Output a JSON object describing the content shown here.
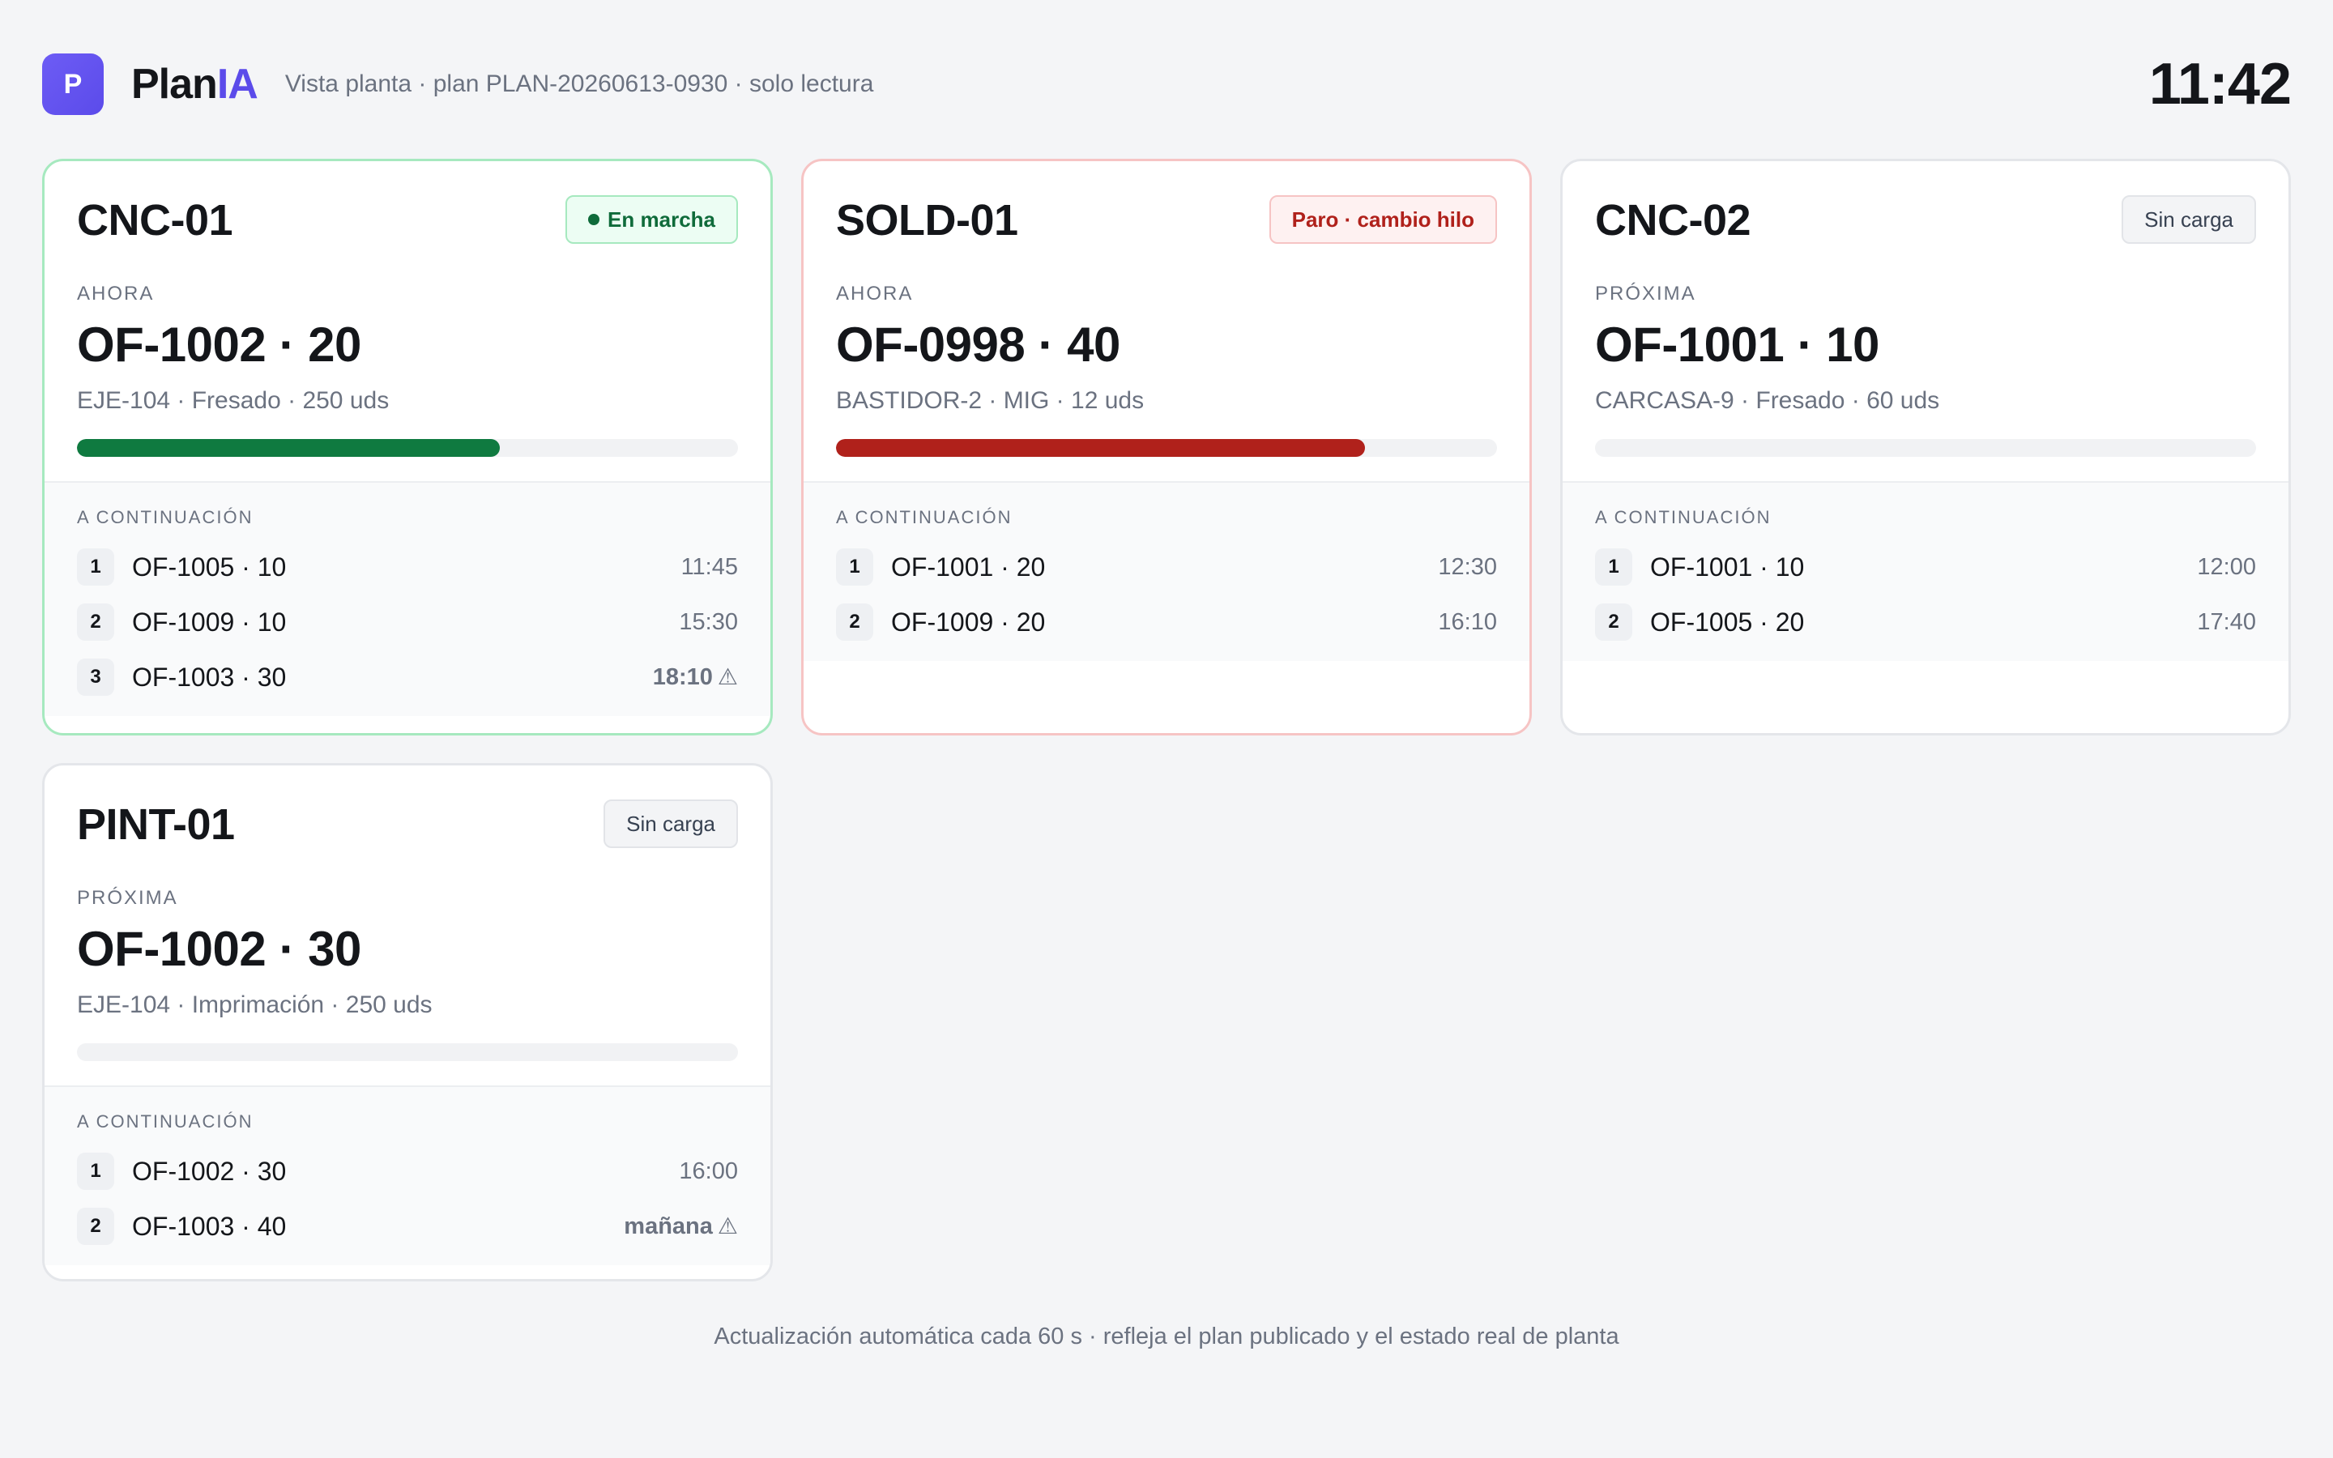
{
  "app": {
    "logo_letter": "P",
    "brand_a": "Plan",
    "brand_b": "IA",
    "subtitle": "Vista planta · plan PLAN-20260613-0930 · solo lectura",
    "clock": "11:42",
    "accent": "#5b4bea"
  },
  "cards": [
    {
      "machine": "CNC-01",
      "status": "En marcha",
      "status_kind": "running",
      "current_label": "AHORA",
      "current_order": "OF-1002 · 20",
      "current_detail": "EJE-104 · Fresado · 250 uds",
      "progress": 0.64,
      "next_label": "A CONTINUACIÓN",
      "queue": [
        {
          "n": "1",
          "order": "OF-1005 · 10",
          "time": "11:45",
          "warn": false
        },
        {
          "n": "2",
          "order": "OF-1009 · 10",
          "time": "15:30",
          "warn": false
        },
        {
          "n": "3",
          "order": "OF-1003 · 30",
          "time": "18:10",
          "warn": true
        }
      ]
    },
    {
      "machine": "SOLD-01",
      "status": "Paro · cambio hilo",
      "status_kind": "stopped",
      "current_label": "AHORA",
      "current_order": "OF-0998 · 40",
      "current_detail": "BASTIDOR-2 · MIG · 12 uds",
      "progress": 0.8,
      "next_label": "A CONTINUACIÓN",
      "queue": [
        {
          "n": "1",
          "order": "OF-1001 · 20",
          "time": "12:30",
          "warn": false
        },
        {
          "n": "2",
          "order": "OF-1009 · 20",
          "time": "16:10",
          "warn": false
        }
      ]
    },
    {
      "machine": "CNC-02",
      "status": "Sin carga",
      "status_kind": "idle",
      "current_label": "PRÓXIMA",
      "current_order": "OF-1001 · 10",
      "current_detail": "CARCASA-9 · Fresado · 60 uds",
      "progress": 0,
      "next_label": "A CONTINUACIÓN",
      "queue": [
        {
          "n": "1",
          "order": "OF-1001 · 10",
          "time": "12:00",
          "warn": false
        },
        {
          "n": "2",
          "order": "OF-1005 · 20",
          "time": "17:40",
          "warn": false
        }
      ]
    },
    {
      "machine": "PINT-01",
      "status": "Sin carga",
      "status_kind": "idle",
      "current_label": "PRÓXIMA",
      "current_order": "OF-1002 · 30",
      "current_detail": "EJE-104 · Imprimación · 250 uds",
      "progress": 0,
      "next_label": "A CONTINUACIÓN",
      "queue": [
        {
          "n": "1",
          "order": "OF-1002 · 30",
          "time": "16:00",
          "warn": false
        },
        {
          "n": "2",
          "order": "OF-1003 · 40",
          "time": "mañana",
          "warn": true
        }
      ]
    }
  ],
  "footer": "Actualización automática cada 60 s · refleja el plan publicado y el estado real de planta",
  "icons": {
    "warning": "warning-triangle-icon"
  },
  "colors": {
    "running": "#0f7a40",
    "stopped": "#b0211b"
  }
}
